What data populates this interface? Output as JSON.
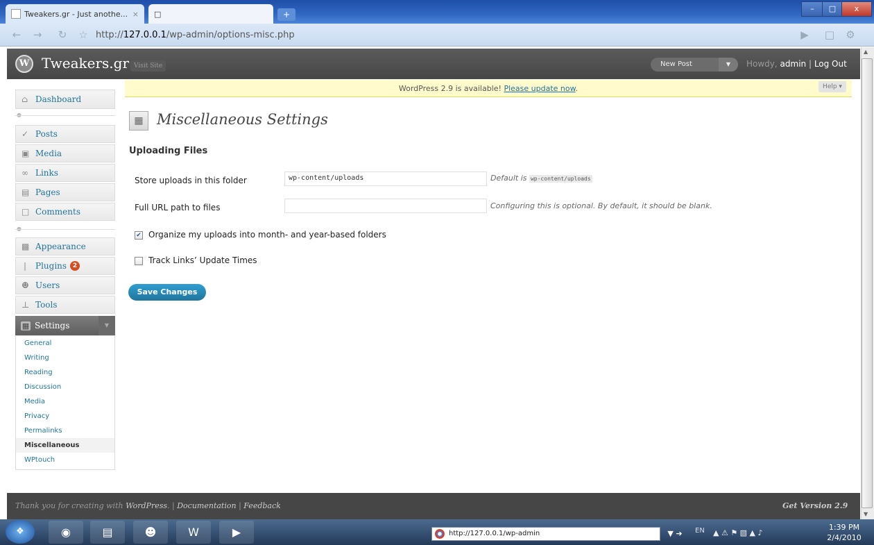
{
  "browser": {
    "tab1_title": "Tweakers.gr - Just anothe...",
    "tab1_close": "×",
    "tab2_icon": "□",
    "new_tab": "+",
    "url_prefix": "http://",
    "url_host": "127.0.0.1",
    "url_path": "/wp-admin/options-misc.php",
    "min": "–",
    "max": "□",
    "close": "x"
  },
  "header": {
    "site_title": "Tweakers.gr",
    "visit_site": "Visit Site",
    "new_post": "New Post",
    "howdy_prefix": "Howdy, ",
    "user": "admin",
    "separator": " | ",
    "logout": "Log Out"
  },
  "nag": {
    "text": "WordPress 2.9 is available! ",
    "link": "Please update now",
    "end": "."
  },
  "help": "Help ▾",
  "menu": {
    "dashboard": "Dashboard",
    "posts": "Posts",
    "media": "Media",
    "links": "Links",
    "pages": "Pages",
    "comments": "Comments",
    "appearance": "Appearance",
    "plugins": "Plugins",
    "plugins_badge": "2",
    "users": "Users",
    "tools": "Tools",
    "settings": "Settings",
    "submenu": [
      "General",
      "Writing",
      "Reading",
      "Discussion",
      "Media",
      "Privacy",
      "Permalinks",
      "Miscellaneous",
      "WPtouch"
    ]
  },
  "page": {
    "title": "Miscellaneous Settings",
    "section": "Uploading Files",
    "store_label": "Store uploads in this folder",
    "store_value": "wp-content/uploads",
    "store_note": "Default is ",
    "store_note_code": "wp-content/uploads",
    "url_label": "Full URL path to files",
    "url_value": "",
    "url_note": "Configuring this is optional. By default, it should be blank.",
    "organize_label": "Organize my uploads into month- and year-based folders",
    "organize_checked": true,
    "track_label": "Track Links’ Update Times",
    "track_checked": false,
    "save": "Save Changes"
  },
  "footer": {
    "thanks": "Thank you for creating with ",
    "wp": "WordPress",
    "sep1": ". | ",
    "docs": "Documentation",
    "sep2": " | ",
    "feedback": "Feedback",
    "version": "Get Version 2.9"
  },
  "taskbar": {
    "url": "http://127.0.0.1/wp-admin",
    "lang": "EN",
    "time": "1:39 PM",
    "date": "2/4/2010"
  },
  "colors": {
    "link": "#21759b",
    "header_bg": "#464646",
    "nag_bg": "#fffbcc",
    "badge": "#d54e21"
  }
}
